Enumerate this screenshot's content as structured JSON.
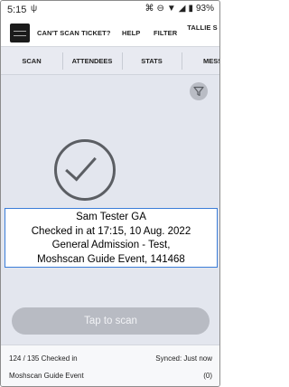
{
  "status_bar": {
    "time": "5:15",
    "battery": "93%",
    "icons": [
      "usb-icon",
      "nfc-icon",
      "do-not-disturb-icon",
      "wifi-icon",
      "signal-icon",
      "battery-icon"
    ]
  },
  "app_bar": {
    "cant_scan": "CAN'T SCAN TICKET?",
    "help": "HELP",
    "filter": "FILTER",
    "tallies": "TALLIE S"
  },
  "tabs": [
    {
      "label": "SCAN"
    },
    {
      "label": "ATTENDEES"
    },
    {
      "label": "STATS"
    },
    {
      "label": "MESSA"
    }
  ],
  "result": {
    "name": "Sam Tester GA",
    "checked_in": "Checked in at 17:15, 10 Aug. 2022",
    "ticket": "General Admission - Test,",
    "event_line": "Moshscan Guide Event, 141468"
  },
  "tap_button": "Tap to scan",
  "footer": {
    "checked_in": "124 / 135 Checked in",
    "synced": "Synced: Just now",
    "event_name": "Moshscan Guide Event",
    "count": "(0)"
  },
  "colors": {
    "background": "#e3e6ee",
    "card_border": "#3b7dd8",
    "button": "#b8bbc3"
  }
}
